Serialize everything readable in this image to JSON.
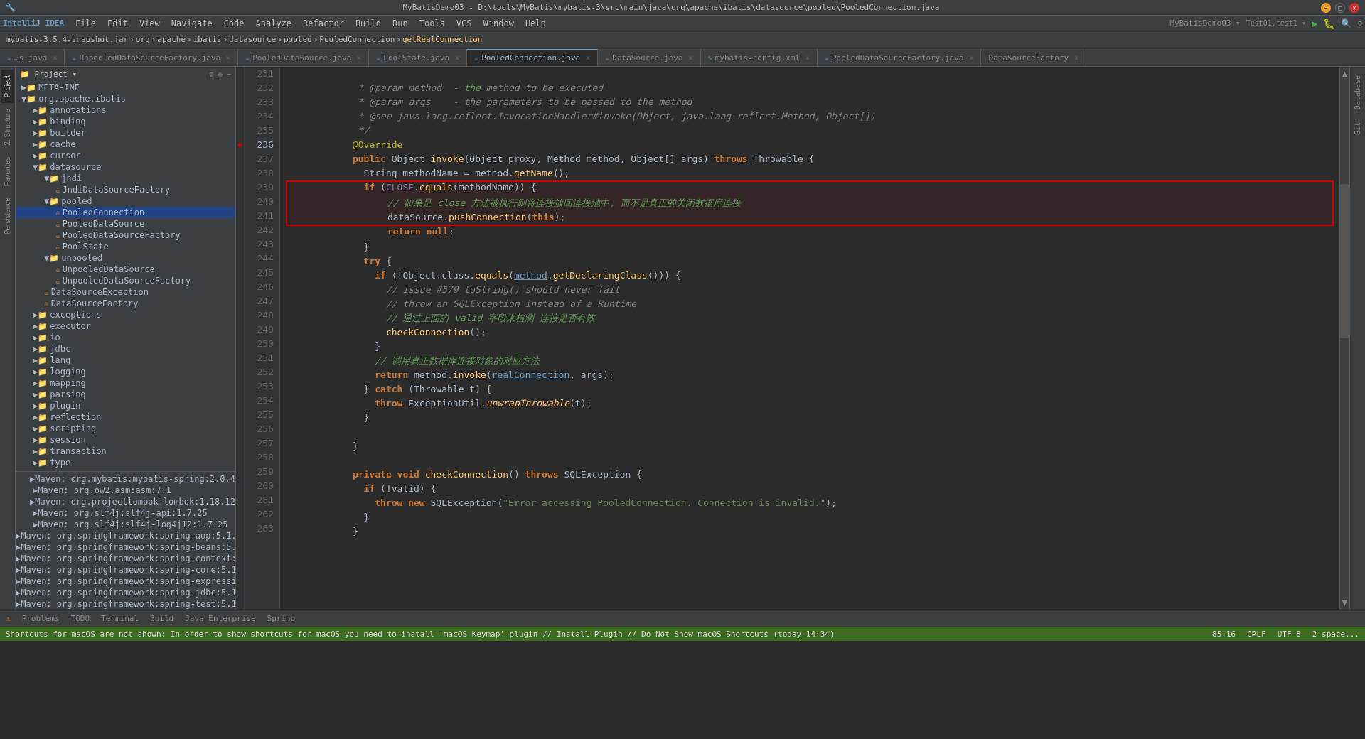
{
  "titlebar": {
    "title": "MyBatisDemo03 - D:\\tools\\MyBatis\\mybatis-3\\src\\main\\java\\org\\apache\\ibatis\\datasource\\pooled\\PooledConnection.java",
    "controls": [
      "minimize",
      "maximize",
      "close"
    ]
  },
  "menubar": {
    "items": [
      "File",
      "Edit",
      "View",
      "Navigate",
      "Code",
      "Analyze",
      "Refactor",
      "Build",
      "Run",
      "Tools",
      "VCS",
      "Window",
      "Help"
    ]
  },
  "breadcrumb": {
    "items": [
      "mybatis-3.5.4-snapshot.jar",
      "org",
      "apache",
      "ibatis",
      "datasource",
      "pooled",
      "PooledConnection",
      "getRealConnection"
    ]
  },
  "tabs": [
    {
      "label": "s.java",
      "active": false
    },
    {
      "label": "UnpooledDataSourceFactory.java",
      "active": false
    },
    {
      "label": "PooledDataSource.java",
      "active": false
    },
    {
      "label": "PoolState.java",
      "active": false
    },
    {
      "label": "PooledConnection.java",
      "active": true
    },
    {
      "label": "DataSource.java",
      "active": false
    },
    {
      "label": "mybatis-config.xml",
      "active": false
    },
    {
      "label": "PooledDataSourceFactory.java",
      "active": false
    },
    {
      "label": "DataSourceFactory",
      "active": false
    }
  ],
  "sidebar": {
    "project_label": "Project",
    "tree": [
      {
        "level": 0,
        "type": "folder",
        "label": "META-INF"
      },
      {
        "level": 0,
        "type": "folder",
        "label": "org.apache.ibatis",
        "expanded": true
      },
      {
        "level": 1,
        "type": "folder",
        "label": "annotations"
      },
      {
        "level": 1,
        "type": "folder",
        "label": "binding"
      },
      {
        "level": 1,
        "type": "folder",
        "label": "builder"
      },
      {
        "level": 1,
        "type": "folder",
        "label": "cache",
        "expanded": false
      },
      {
        "level": 1,
        "type": "folder",
        "label": "cursor"
      },
      {
        "level": 1,
        "type": "folder",
        "label": "datasource",
        "expanded": true
      },
      {
        "level": 2,
        "type": "folder",
        "label": "jndi",
        "expanded": true
      },
      {
        "level": 3,
        "type": "java",
        "label": "JndiDataSourceFactory"
      },
      {
        "level": 2,
        "type": "folder",
        "label": "pooled",
        "expanded": true
      },
      {
        "level": 3,
        "type": "java",
        "label": "PooledConnection",
        "selected": true
      },
      {
        "level": 3,
        "type": "java",
        "label": "PooledDataSource"
      },
      {
        "level": 3,
        "type": "java",
        "label": "PooledDataSourceFactory"
      },
      {
        "level": 3,
        "type": "java",
        "label": "PoolState"
      },
      {
        "level": 2,
        "type": "folder",
        "label": "unpooled",
        "expanded": true
      },
      {
        "level": 3,
        "type": "java",
        "label": "UnpooledDataSource"
      },
      {
        "level": 3,
        "type": "java",
        "label": "UnpooledDataSourceFactory"
      },
      {
        "level": 2,
        "type": "java",
        "label": "DataSourceException"
      },
      {
        "level": 2,
        "type": "java",
        "label": "DataSourceFactory"
      },
      {
        "level": 1,
        "type": "folder",
        "label": "exceptions"
      },
      {
        "level": 1,
        "type": "folder",
        "label": "executor"
      },
      {
        "level": 1,
        "type": "folder",
        "label": "io"
      },
      {
        "level": 1,
        "type": "folder",
        "label": "jdbc"
      },
      {
        "level": 1,
        "type": "folder",
        "label": "lang"
      },
      {
        "level": 1,
        "type": "folder",
        "label": "logging"
      },
      {
        "level": 1,
        "type": "folder",
        "label": "mapping"
      },
      {
        "level": 1,
        "type": "folder",
        "label": "parsing"
      },
      {
        "level": 1,
        "type": "folder",
        "label": "plugin"
      },
      {
        "level": 1,
        "type": "folder",
        "label": "reflection"
      },
      {
        "level": 1,
        "type": "folder",
        "label": "scripting"
      },
      {
        "level": 1,
        "type": "folder",
        "label": "session"
      },
      {
        "level": 1,
        "type": "folder",
        "label": "transaction"
      },
      {
        "level": 1,
        "type": "folder",
        "label": "type"
      }
    ],
    "maven_items": [
      "Maven: org.mybatis:mybatis-spring:2.0.4",
      "Maven: org.ow2.asm:asm:7.1",
      "Maven: org.projectlombok:lombok:1.18.12",
      "Maven: org.slf4j:slf4j-api:1.7.25",
      "Maven: org.slf4j:slf4j-log4j12:1.7.25",
      "Maven: org.springframework:spring-aop:5.1.6.RELEA",
      "Maven: org.springframework:spring-beans:5.1.6.RELE",
      "Maven: org.springframework:spring-context:5.1.6.RE",
      "Maven: org.springframework:spring-core:5.1.6.RELEA",
      "Maven: org.springframework:spring-expression:5.1.6",
      "Maven: org.springframework:spring-jdbc:5.1.6.RELEA",
      "Maven: org.springframework:spring-test:5.1.6.RELEA"
    ]
  },
  "code": {
    "lines": [
      {
        "num": 231,
        "content": " * @param method  - the method to be executed",
        "type": "comment"
      },
      {
        "num": 232,
        "content": " * @param args    - the parameters to be passed to the method",
        "type": "comment"
      },
      {
        "num": 233,
        "content": " * @see java.lang.reflect.InvocationHandler#invoke(Object, java.lang.reflect.Method, Object[])",
        "type": "comment"
      },
      {
        "num": 234,
        "content": " */",
        "type": "comment"
      },
      {
        "num": 235,
        "content": "@Override",
        "type": "annotation"
      },
      {
        "num": 236,
        "content": "public Object invoke(Object proxy, Method method, Object[] args) throws Throwable {",
        "type": "code"
      },
      {
        "num": 237,
        "content": "    String methodName = method.getName();",
        "type": "code"
      },
      {
        "num": 238,
        "content": "    if (CLOSE.equals(methodName)) {",
        "type": "code"
      },
      {
        "num": 239,
        "content": "        // 如果是 close 方法被执行则将连接放回连接池中, 而不是真正的关闭数据库连接",
        "type": "comment-cn",
        "boxed": true
      },
      {
        "num": 240,
        "content": "        dataSource.pushConnection(this);",
        "type": "code",
        "boxed": true
      },
      {
        "num": 241,
        "content": "        return null;",
        "type": "code",
        "boxed": true
      },
      {
        "num": 242,
        "content": "    }",
        "type": "code"
      },
      {
        "num": 243,
        "content": "    try {",
        "type": "code"
      },
      {
        "num": 244,
        "content": "        if (!Object.class.equals(method.getDeclaringClass())) {",
        "type": "code"
      },
      {
        "num": 245,
        "content": "            // issue #579 toString() should never fail",
        "type": "comment"
      },
      {
        "num": 246,
        "content": "            // throw an SQLException instead of a Runtime",
        "type": "comment"
      },
      {
        "num": 247,
        "content": "            // 通过上面的 valid 字段来检测 连接是否有效",
        "type": "comment-cn"
      },
      {
        "num": 248,
        "content": "            checkConnection();",
        "type": "code"
      },
      {
        "num": 249,
        "content": "        }",
        "type": "code"
      },
      {
        "num": 250,
        "content": "        // 调用真正数据库连接对象的对应方法",
        "type": "comment-cn"
      },
      {
        "num": 251,
        "content": "        return method.invoke(realConnection, args);",
        "type": "code"
      },
      {
        "num": 252,
        "content": "    } catch (Throwable t) {",
        "type": "code"
      },
      {
        "num": 253,
        "content": "        throw ExceptionUtil.unwrapThrowable(t);",
        "type": "code"
      },
      {
        "num": 254,
        "content": "    }",
        "type": "code"
      },
      {
        "num": 255,
        "content": "",
        "type": "empty"
      },
      {
        "num": 256,
        "content": "}",
        "type": "code"
      },
      {
        "num": 257,
        "content": "",
        "type": "empty"
      },
      {
        "num": 258,
        "content": "private void checkConnection() throws SQLException {",
        "type": "code"
      },
      {
        "num": 259,
        "content": "    if (!valid) {",
        "type": "code"
      },
      {
        "num": 260,
        "content": "        throw new SQLException(\"Error accessing PooledConnection. Connection is invalid.\");",
        "type": "code"
      },
      {
        "num": 261,
        "content": "    }",
        "type": "code"
      },
      {
        "num": 262,
        "content": "}",
        "type": "code"
      },
      {
        "num": 263,
        "content": "",
        "type": "empty"
      }
    ]
  },
  "statusbar": {
    "message": "Shortcuts for macOS are not shown: In order to show shortcuts for macOS you need to install 'macOS Keymap' plugin // Install Plugin // Do Not Show macOS Shortcuts (today 14:34)",
    "line_col": "85:16",
    "encoding": "CRLF",
    "charset": "UTF-8",
    "indent": "2 space..."
  },
  "bottom_tabs": {
    "items": [
      "Problems",
      "TODO",
      "Terminal",
      "Build",
      "Java Enterprise",
      "Spring"
    ]
  }
}
